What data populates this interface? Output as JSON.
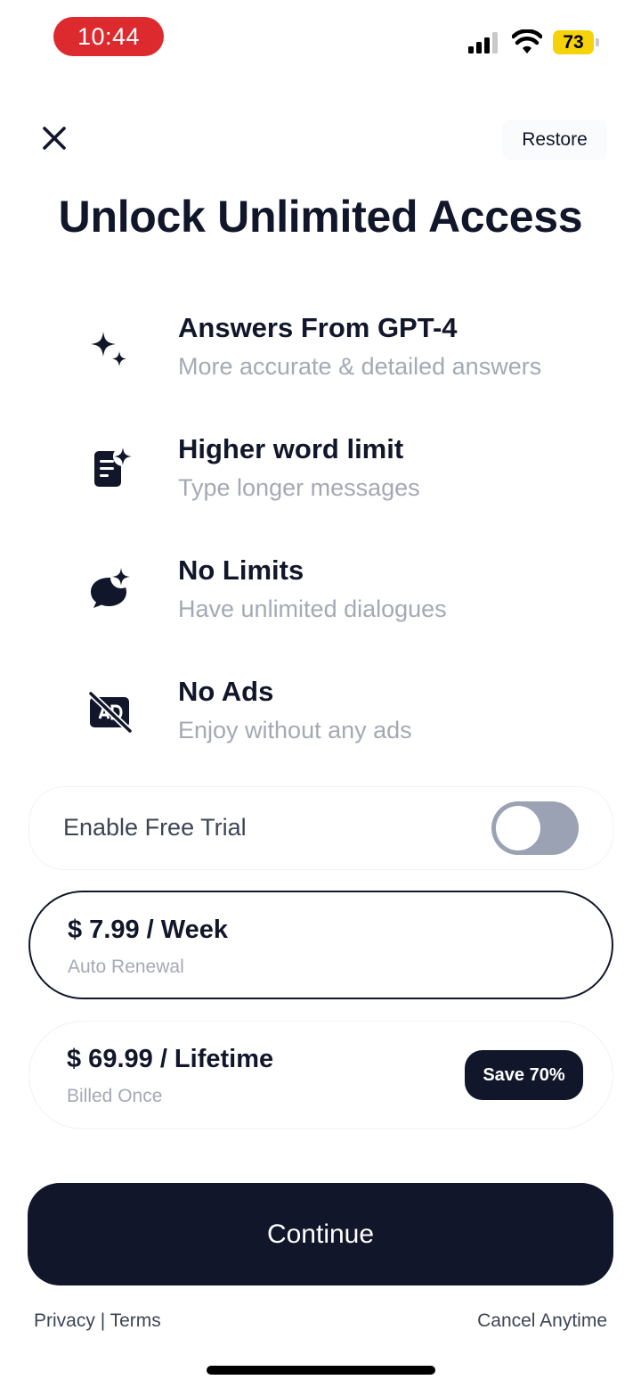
{
  "status_bar": {
    "time": "10:44",
    "battery": "73",
    "icons": [
      "signal-icon",
      "wifi-icon",
      "battery-icon"
    ]
  },
  "header": {
    "close_icon": "close-icon",
    "restore_label": "Restore",
    "title": "Unlock Unlimited Access"
  },
  "features": [
    {
      "icon": "sparkles-icon",
      "title": "Answers From GPT-4",
      "subtitle": "More accurate & detailed answers"
    },
    {
      "icon": "document-sparkle-icon",
      "title": "Higher word limit",
      "subtitle": "Type longer messages"
    },
    {
      "icon": "chat-sparkle-icon",
      "title": "No Limits",
      "subtitle": "Have unlimited dialogues"
    },
    {
      "icon": "no-ads-icon",
      "title": "No Ads",
      "subtitle": "Enjoy without any ads"
    }
  ],
  "trial": {
    "label": "Enable Free Trial",
    "enabled": false
  },
  "plans": [
    {
      "price": "$ 7.99 / Week",
      "note": "Auto Renewal",
      "selected": true
    },
    {
      "price": "$ 69.99 / Lifetime",
      "note": "Billed Once",
      "selected": false,
      "badge": "Save 70%"
    }
  ],
  "continue_label": "Continue",
  "footer": {
    "privacy": "Privacy",
    "separator": " | ",
    "terms": "Terms",
    "cancel": "Cancel Anytime"
  },
  "colors": {
    "primary": "#11162a",
    "muted_text": "#a5a9b4",
    "time_pill": "#dc2a2f",
    "battery": "#f5d20a",
    "toggle_off": "#9aa2b3"
  }
}
